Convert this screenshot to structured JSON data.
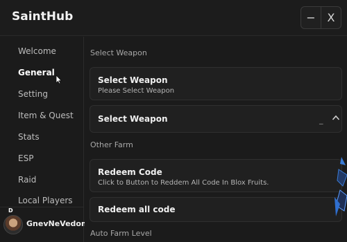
{
  "app": {
    "title": "SaintHub"
  },
  "window_controls": {
    "minimize": "−",
    "close": "X"
  },
  "sidebar": {
    "items": [
      {
        "label": "Welcome",
        "active": false
      },
      {
        "label": "General",
        "active": true
      },
      {
        "label": "Setting",
        "active": false
      },
      {
        "label": "Item & Quest",
        "active": false
      },
      {
        "label": "Stats",
        "active": false
      },
      {
        "label": "ESP",
        "active": false
      },
      {
        "label": "Raid",
        "active": false
      },
      {
        "label": "Local Players",
        "active": false
      }
    ],
    "user": {
      "badge": "D",
      "name": "GnevNeVedom"
    }
  },
  "main": {
    "section1": "Select Weapon",
    "select_weapon_card": {
      "title": "Select Weapon",
      "desc": "Please Select Weapon"
    },
    "select_weapon_dropdown": {
      "title": "Select Weapon",
      "value": "_"
    },
    "section2": "Other Farm",
    "redeem_code_card": {
      "title": "Redeem Code",
      "desc": "Click to Button to Reddem All Code In Blox Fruits."
    },
    "redeem_all_button": {
      "title": "Redeem all code"
    },
    "section3": "Auto Farm Level"
  },
  "colors": {
    "background": "#1b1b1b",
    "card": "#202020",
    "border": "#2f2f2f",
    "text_primary": "#f0f0f0",
    "text_secondary": "#b5b5b5",
    "edge_accent": "#3a7bd5"
  }
}
